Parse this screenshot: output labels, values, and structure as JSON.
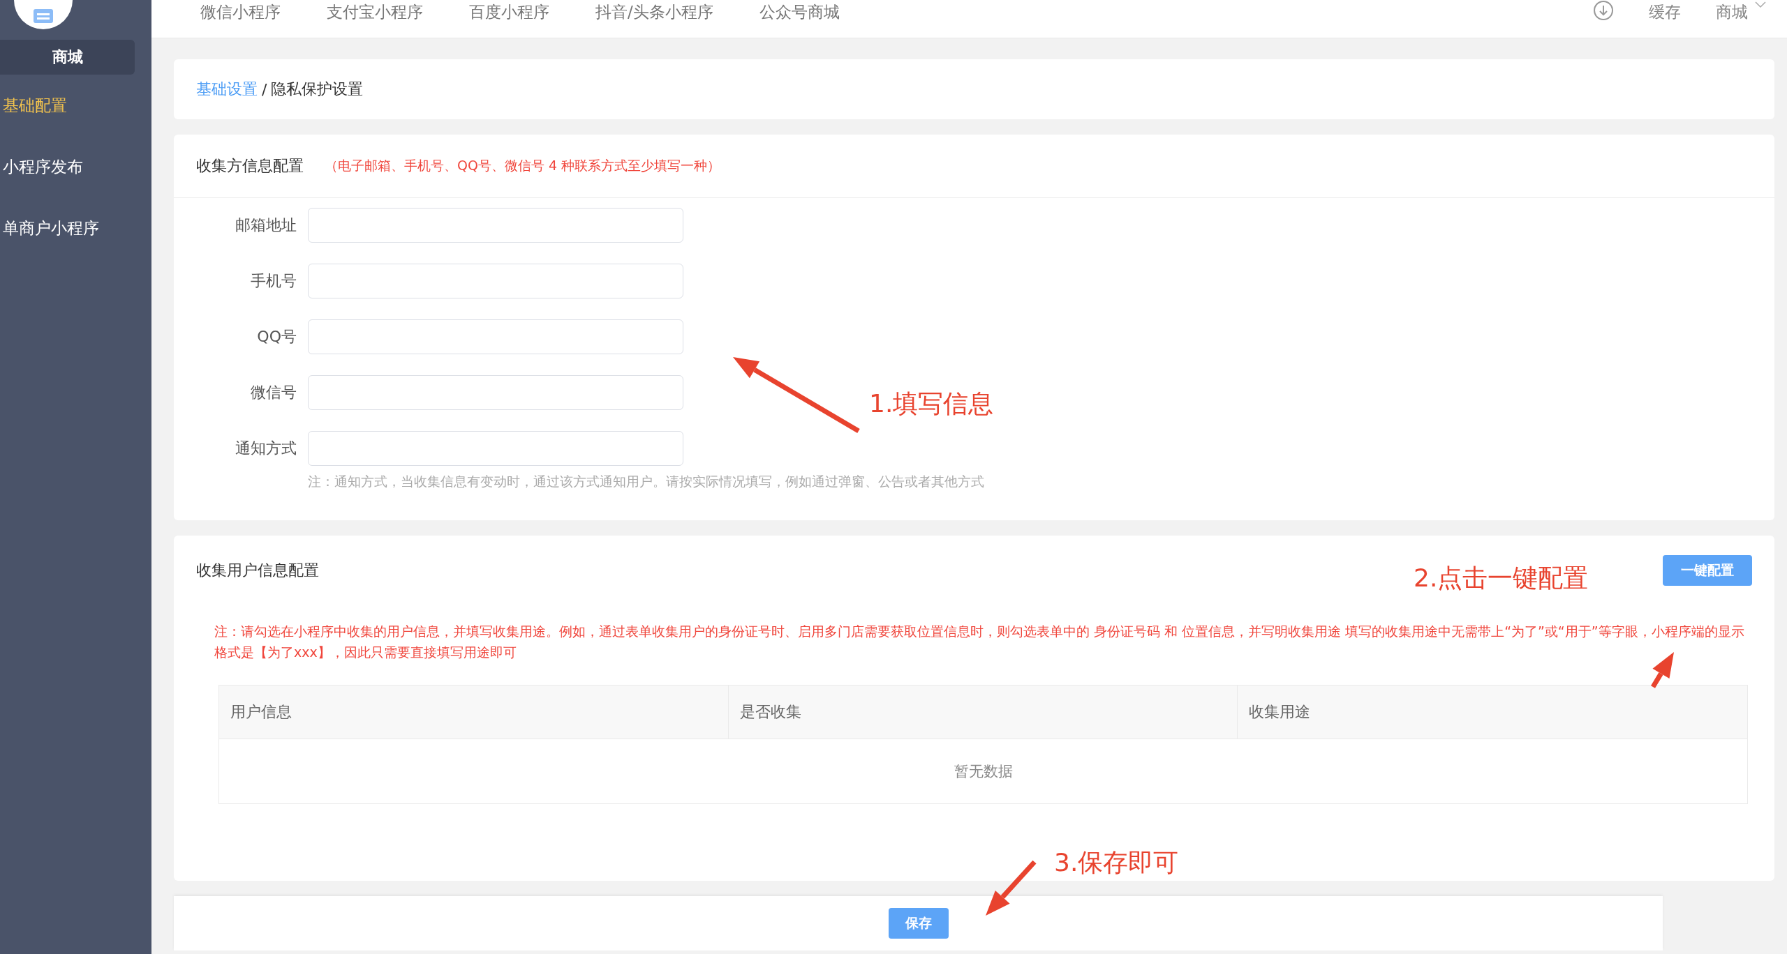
{
  "sidebar": {
    "shop_label": "商城",
    "items": [
      {
        "label": "基础配置",
        "selected": true
      },
      {
        "label": "小程序发布",
        "selected": false
      },
      {
        "label": "单商户小程序",
        "selected": false
      }
    ]
  },
  "top_nav": {
    "items": [
      "微信小程序",
      "支付宝小程序",
      "百度小程序",
      "抖音/头条小程序",
      "公众号商城"
    ],
    "cache": "缓存",
    "account": "商城"
  },
  "breadcrumb": {
    "link": "基础设置",
    "separator": "/",
    "current": "隐私保护设置"
  },
  "collector_section": {
    "title": "收集方信息配置",
    "notice": "（电子邮箱、手机号、QQ号、微信号 4 种联系方式至少填写一种）",
    "fields": [
      {
        "label": "邮箱地址"
      },
      {
        "label": "手机号"
      },
      {
        "label": "QQ号"
      },
      {
        "label": "微信号"
      },
      {
        "label": "通知方式"
      }
    ],
    "hint": "注：通知方式，当收集信息有变动时，通过该方式通知用户。请按实际情况填写，例如通过弹窗、公告或者其他方式"
  },
  "user_info_section": {
    "title": "收集用户信息配置",
    "button": "一键配置",
    "note": "注：请勾选在小程序中收集的用户信息，并填写收集用途。例如，通过表单收集用户的身份证号时、启用多门店需要获取位置信息时，则勾选表单中的 身份证号码 和 位置信息，并写明收集用途 填写的收集用途中无需带上“为了”或“用于”等字眼，小程序端的显示格式是【为了xxx】，因此只需要直接填写用途即可",
    "table": {
      "columns": [
        "用户信息",
        "是否收集",
        "收集用途"
      ],
      "empty_text": "暂无数据"
    }
  },
  "save_button": "保存",
  "annotations": [
    {
      "text": "1.填写信息"
    },
    {
      "text": "2.点击一键配置"
    },
    {
      "text": "3.保存即可"
    }
  ]
}
